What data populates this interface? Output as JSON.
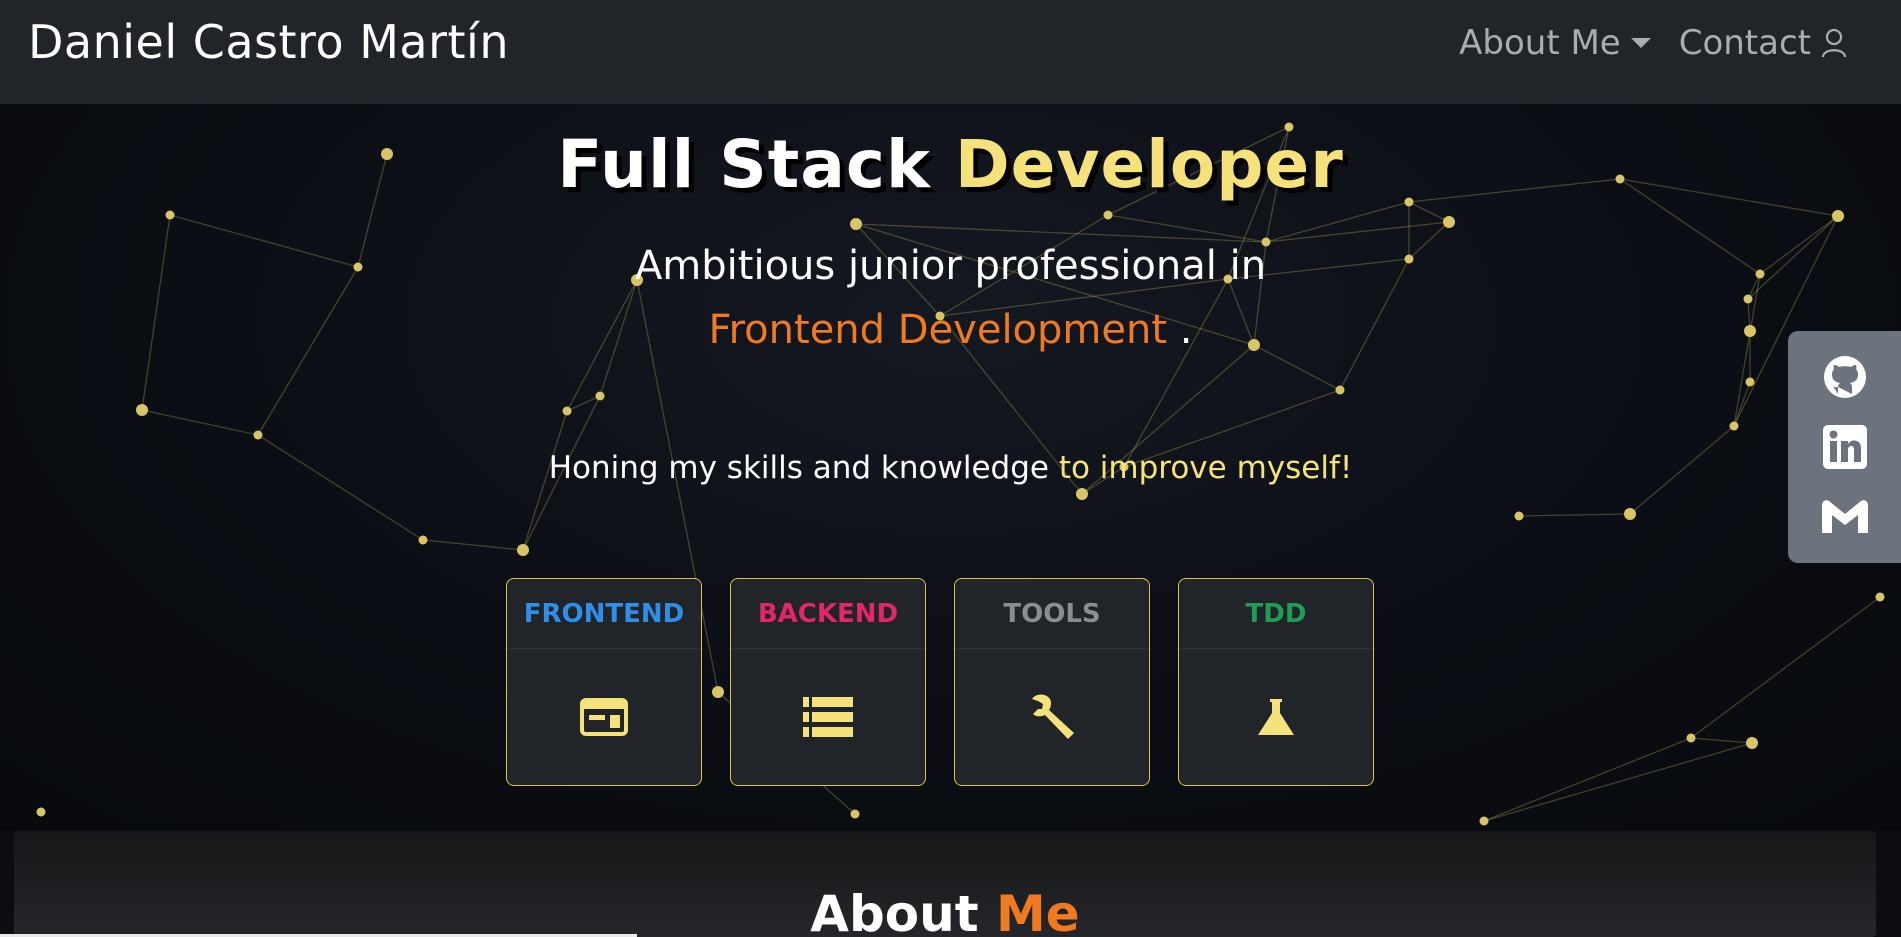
{
  "navbar": {
    "brand": "Daniel Castro Martín",
    "about_label": "About Me",
    "contact_label": "Contact"
  },
  "hero": {
    "title_part1": "Full Stack",
    "title_part2": "Developer",
    "subtitle_line1": "Ambitious junior professional in",
    "subtitle_highlight": "Frontend Development",
    "subtitle_end": " .",
    "tagline_part1": "Honing my skills and knowledge ",
    "tagline_part2": "to improve myself!"
  },
  "cards": [
    {
      "title": "FRONTEND",
      "color": "#2e8fe8",
      "icon": "browser-window-icon"
    },
    {
      "title": "BACKEND",
      "color": "#e2266b",
      "icon": "server-stack-icon"
    },
    {
      "title": "TOOLS",
      "color": "#8a8d91",
      "icon": "wrench-icon"
    },
    {
      "title": "TDD",
      "color": "#1f9d55",
      "icon": "flask-icon"
    }
  ],
  "social": [
    "github-icon",
    "linkedin-icon",
    "gmail-icon"
  ],
  "about": {
    "title_part1": "About ",
    "title_part2": "Me"
  },
  "colors": {
    "accent_yellow": "#f6e27a",
    "accent_orange": "#f07a1f",
    "navbar_bg": "#212428",
    "card_border": "#e0c34a"
  }
}
